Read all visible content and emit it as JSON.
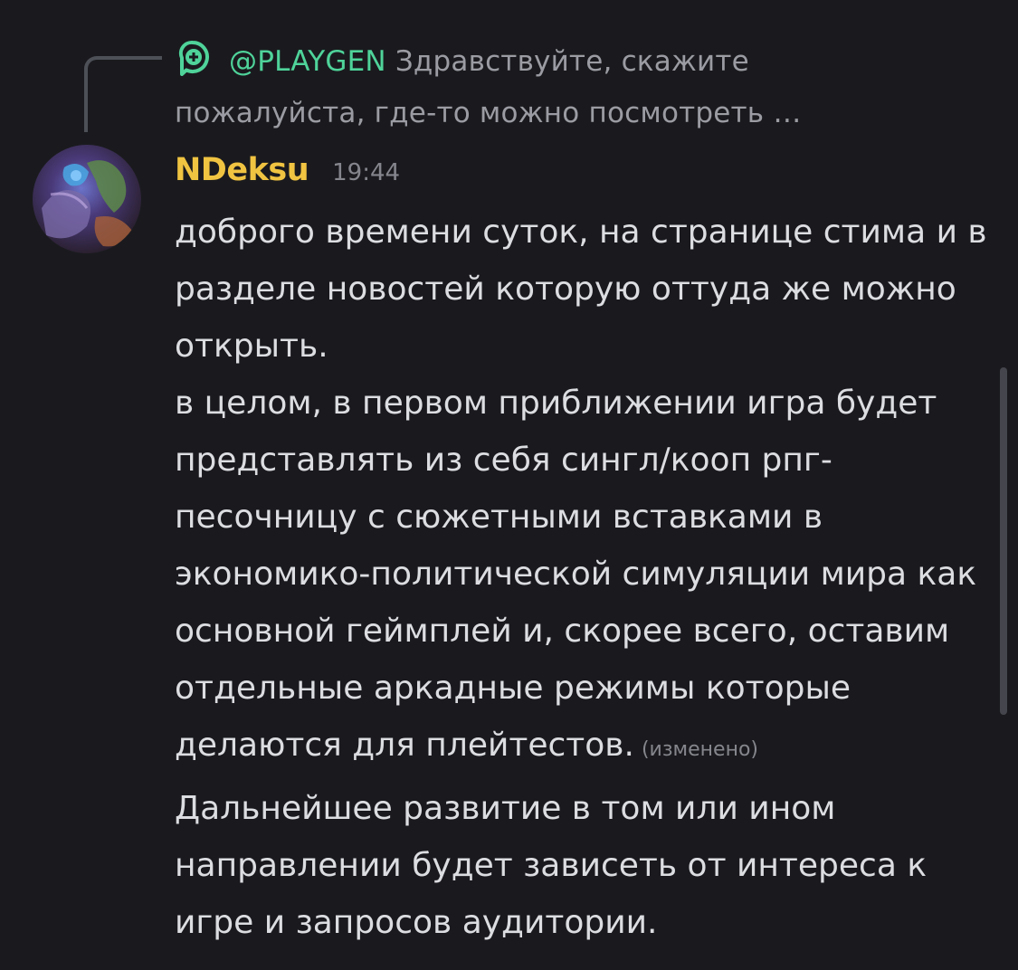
{
  "reply": {
    "author": "@PLAYGEN",
    "preview_line1": "Здравствуйте, скажите",
    "preview_line2": "пожалуйста, где-то можно посмотреть …",
    "icon": "plus-bubble-icon",
    "author_color": "#4fd39a"
  },
  "message": {
    "author": "NDeksu",
    "author_color": "#f0c341",
    "timestamp": "19:44",
    "avatar": "avatar-fantasy-character",
    "paragraph1": "доброго времени суток, на странице стима и в разделе новостей которую оттуда же можно открыть.",
    "paragraph2": "в целом, в первом приближении игра будет представлять из себя сингл/кооп рпг-песочницу с сюжетными вставками в экономико-политической симуляции мира как основной геймплей и, скорее всего, оставим отдельные аркадные режимы которые делаются для плейтестов.",
    "edited_label": "(изменено)",
    "paragraph3": "Дальнейшее развитие в том или ином направлении будет зависеть от интереса к игре и запросов аудитории."
  }
}
